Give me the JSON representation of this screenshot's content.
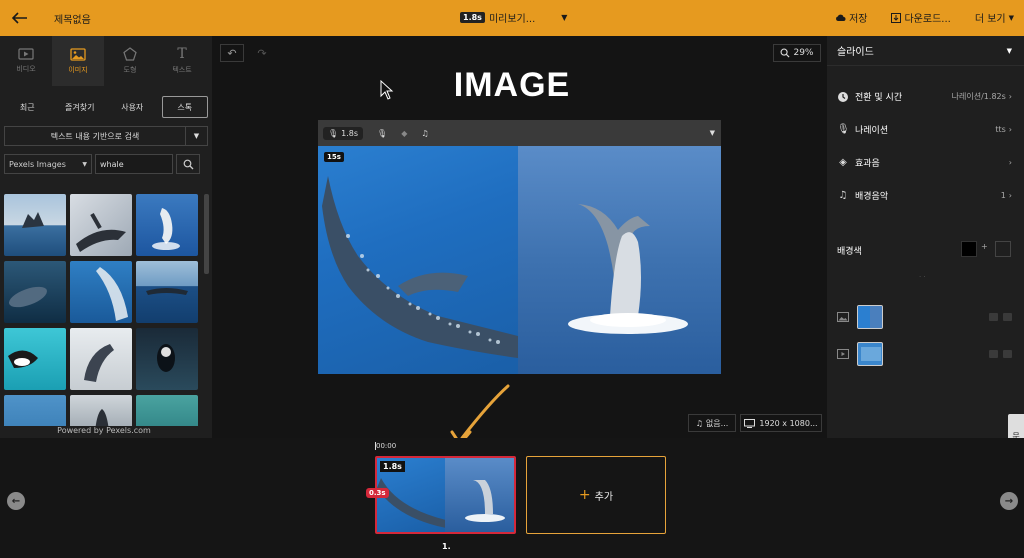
{
  "topbar": {
    "title": "제목없음",
    "preview_duration": "1.8s",
    "preview_label": "미리보기...",
    "save_label": "저장",
    "download_label": "다운로드...",
    "more_label": "더 보기"
  },
  "left_panel": {
    "tool_tabs": [
      {
        "label": "비디오",
        "icon": "video-icon"
      },
      {
        "label": "이미지",
        "icon": "image-icon",
        "active": true
      },
      {
        "label": "도형",
        "icon": "shape-icon"
      },
      {
        "label": "텍스트",
        "icon": "text-icon"
      }
    ],
    "sub_tabs": [
      "최근",
      "즐겨찾기",
      "사용자",
      "스톡"
    ],
    "active_sub_tab": "스톡",
    "search_mode": "텍스트 내용 기반으로 검색",
    "source": "Pexels Images",
    "query": "whale",
    "powered_by": "Powered by Pexels.com"
  },
  "canvas": {
    "zoom": "29%",
    "slide_title": "IMAGE",
    "media_duration": "1.8s",
    "image_badge": "15s",
    "music_label": "없음...",
    "resolution": "1920 x 1080..."
  },
  "right_panel": {
    "header": "슬라이드",
    "rows": [
      {
        "label": "전환 및 시간",
        "value": "나레이션/1.82s",
        "icon": "clock-icon"
      },
      {
        "label": "나레이션",
        "value": "tts",
        "icon": "mic-icon"
      },
      {
        "label": "효과음",
        "value": "",
        "icon": "sound-icon"
      },
      {
        "label": "배경음악",
        "value": "1",
        "icon": "music-icon"
      }
    ],
    "bg_color_label": "배경색",
    "bg_color": "#000000",
    "side_tab": "문의"
  },
  "timeline": {
    "time_start": "00:00",
    "clip_duration": "1.8s",
    "transition": "0.3s",
    "add_label": "추가",
    "clip_number": "1."
  },
  "colors": {
    "accent": "#e69a1f",
    "clip_border": "#d4283a"
  }
}
